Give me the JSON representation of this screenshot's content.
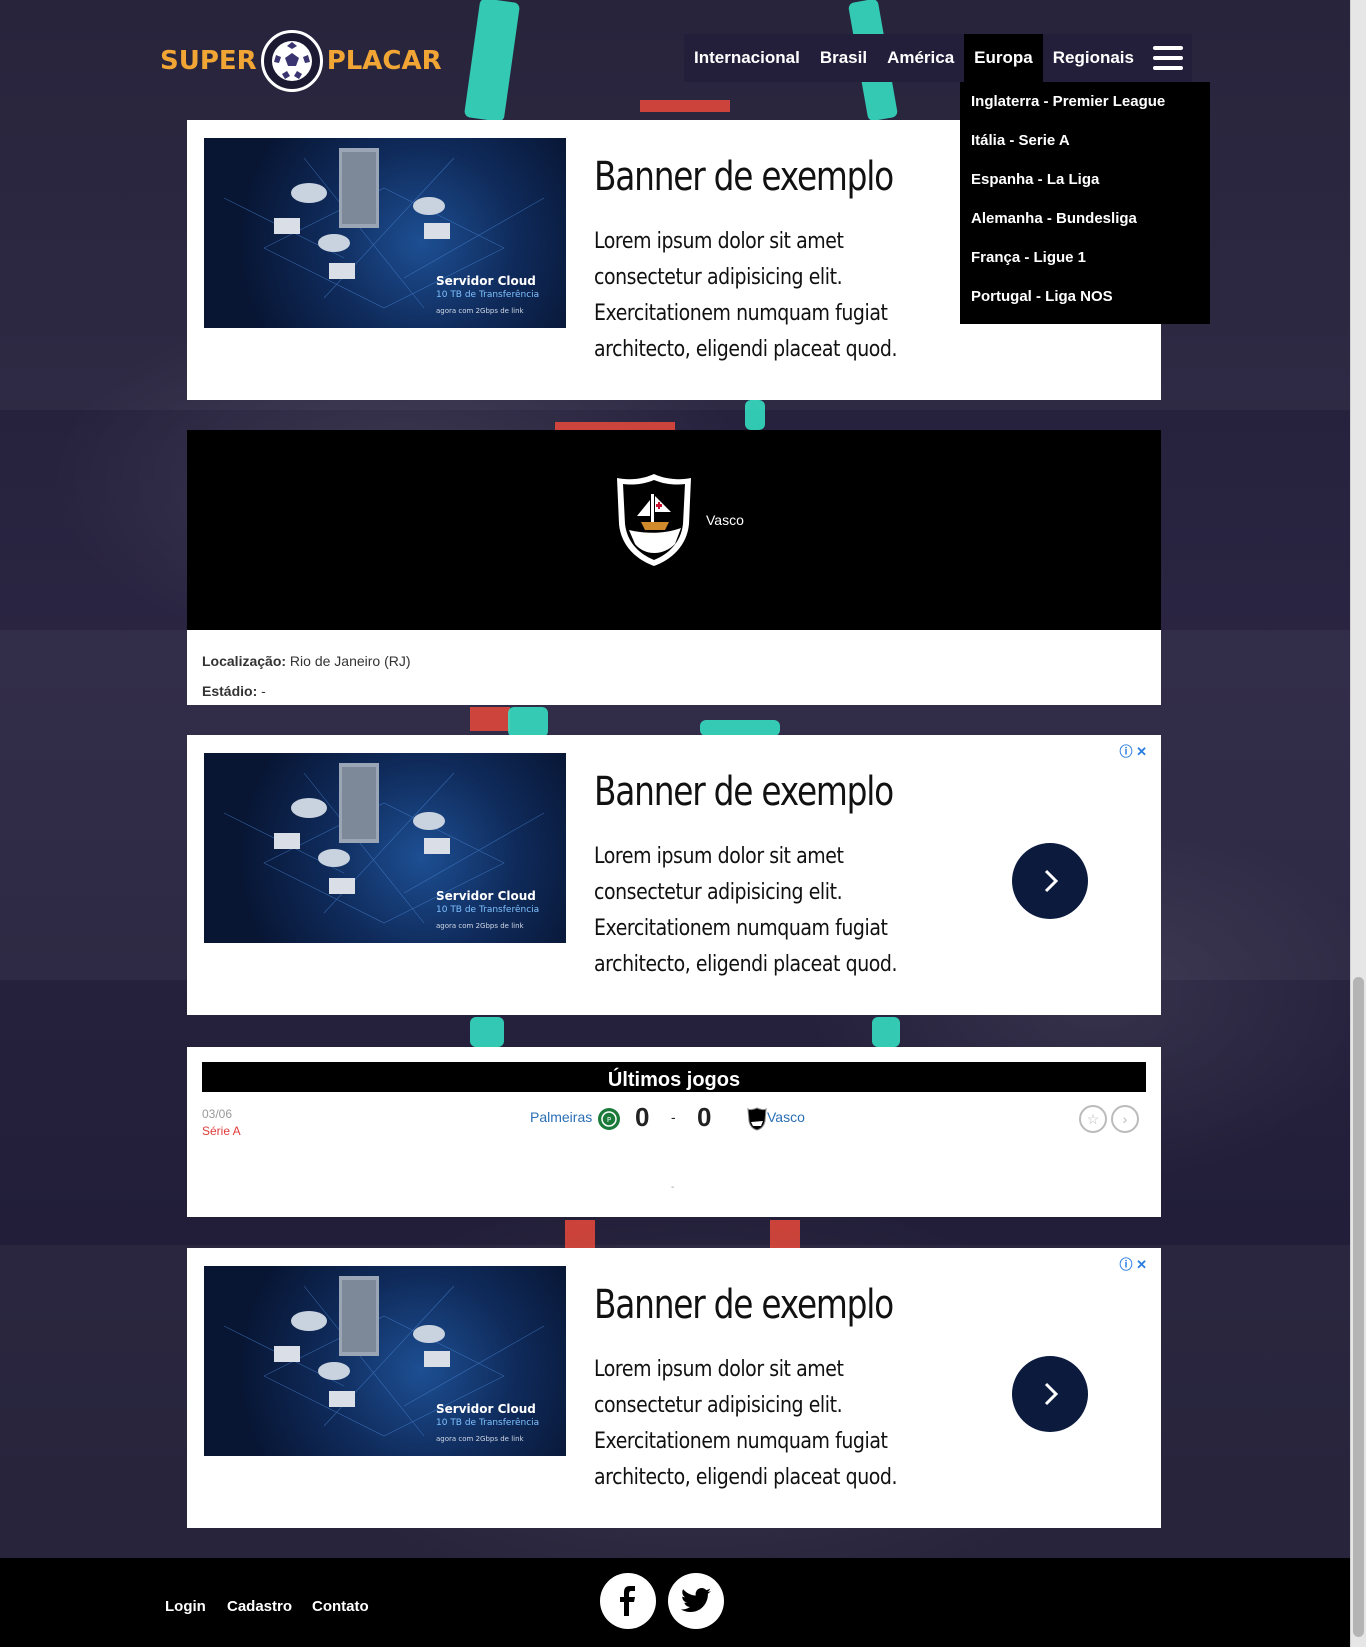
{
  "logo": {
    "left_text": "SUPER",
    "right_text": "PLACAR"
  },
  "nav": {
    "items": [
      {
        "label": "Internacional"
      },
      {
        "label": "Brasil"
      },
      {
        "label": "América"
      },
      {
        "label": "Europa"
      },
      {
        "label": "Regionais"
      }
    ],
    "active": "Europa"
  },
  "dropdown": {
    "items": [
      {
        "label": "Inglaterra - Premier League"
      },
      {
        "label": "Itália - Serie A"
      },
      {
        "label": "Espanha - La Liga"
      },
      {
        "label": "Alemanha - Bundesliga"
      },
      {
        "label": "França - Ligue 1"
      },
      {
        "label": "Portugal - Liga NOS"
      }
    ]
  },
  "ads": [
    {
      "title": "Banner de exemplo",
      "body": "Lorem ipsum dolor sit amet consectetur adipisicing elit. Exercitationem numquam fugiat architecto, eligendi placeat quod.",
      "image_line1": "Servidor Cloud",
      "image_line2": "10 TB de Transferência",
      "image_line3": "agora com 2Gbps de link"
    },
    {
      "title": "Banner de exemplo",
      "body": "Lorem ipsum dolor sit amet consectetur adipisicing elit. Exercitationem numquam fugiat architecto, eligendi placeat quod.",
      "image_line1": "Servidor Cloud",
      "image_line2": "10 TB de Transferência",
      "image_line3": "agora com 2Gbps de link"
    },
    {
      "title": "Banner de exemplo",
      "body": "Lorem ipsum dolor sit amet consectetur adipisicing elit. Exercitationem numquam fugiat architecto, eligendi placeat quod.",
      "image_line1": "Servidor Cloud",
      "image_line2": "10 TB de Transferência",
      "image_line3": "agora com 2Gbps de link"
    }
  ],
  "team": {
    "name": "Vasco",
    "location_label": "Localização:",
    "location_value": "Rio de Janeiro (RJ)",
    "stadium_label": "Estádio:",
    "stadium_value": "-"
  },
  "games": {
    "title": "Últimos jogos",
    "list": [
      {
        "date": "03/06",
        "competition": "Série A",
        "home": "Palmeiras",
        "home_score": "0",
        "separator": "-",
        "away_score": "0",
        "away": "Vasco"
      }
    ],
    "footer_dash": "-"
  },
  "footer": {
    "links": [
      {
        "label": "Login"
      },
      {
        "label": "Cadastro"
      },
      {
        "label": "Contato"
      }
    ],
    "social": [
      "facebook-icon",
      "twitter-icon"
    ]
  },
  "colors": {
    "brand_orange": "#f0a534",
    "ad_button": "#0b1a3d",
    "accent_teal": "#35e6c8",
    "competition_red": "#e03a3a",
    "team_link_blue": "#2a6fb5"
  }
}
